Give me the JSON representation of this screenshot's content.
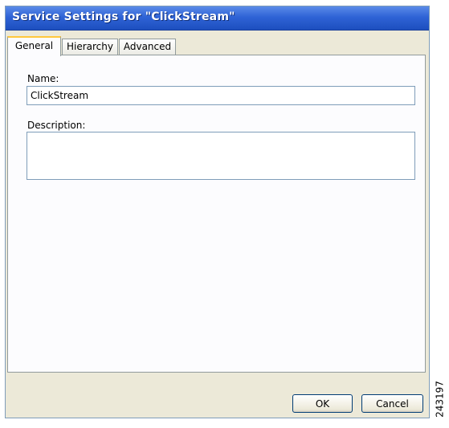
{
  "window": {
    "title": "Service Settings for \"ClickStream\""
  },
  "tabs": [
    {
      "label": "General",
      "active": true
    },
    {
      "label": "Hierarchy",
      "active": false
    },
    {
      "label": "Advanced",
      "active": false
    }
  ],
  "form": {
    "name_label": "Name:",
    "name_value": "ClickStream",
    "description_label": "Description:",
    "description_value": ""
  },
  "buttons": {
    "ok_label": "OK",
    "cancel_label": "Cancel"
  },
  "figure_id": "243197",
  "colors": {
    "titlebar": "#2f63d6",
    "dialog_face": "#ece9d8",
    "panel": "#fcfcfe",
    "active_tab_accent": "#ffc83c"
  }
}
